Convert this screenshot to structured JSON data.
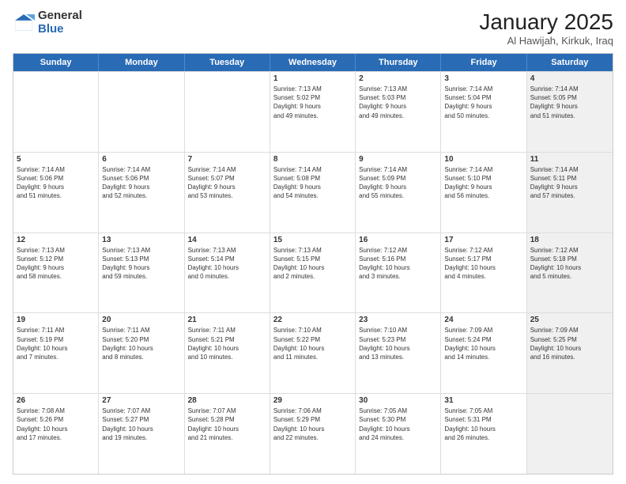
{
  "header": {
    "logo_general": "General",
    "logo_blue": "Blue",
    "month_title": "January 2025",
    "subtitle": "Al Hawijah, Kirkuk, Iraq"
  },
  "days_of_week": [
    "Sunday",
    "Monday",
    "Tuesday",
    "Wednesday",
    "Thursday",
    "Friday",
    "Saturday"
  ],
  "weeks": [
    [
      {
        "num": "",
        "text": "",
        "empty": true,
        "shaded": false
      },
      {
        "num": "",
        "text": "",
        "empty": true,
        "shaded": false
      },
      {
        "num": "",
        "text": "",
        "empty": true,
        "shaded": false
      },
      {
        "num": "1",
        "text": "Sunrise: 7:13 AM\nSunset: 5:02 PM\nDaylight: 9 hours\nand 49 minutes.",
        "empty": false,
        "shaded": false
      },
      {
        "num": "2",
        "text": "Sunrise: 7:13 AM\nSunset: 5:03 PM\nDaylight: 9 hours\nand 49 minutes.",
        "empty": false,
        "shaded": false
      },
      {
        "num": "3",
        "text": "Sunrise: 7:14 AM\nSunset: 5:04 PM\nDaylight: 9 hours\nand 50 minutes.",
        "empty": false,
        "shaded": false
      },
      {
        "num": "4",
        "text": "Sunrise: 7:14 AM\nSunset: 5:05 PM\nDaylight: 9 hours\nand 51 minutes.",
        "empty": false,
        "shaded": true
      }
    ],
    [
      {
        "num": "5",
        "text": "Sunrise: 7:14 AM\nSunset: 5:06 PM\nDaylight: 9 hours\nand 51 minutes.",
        "empty": false,
        "shaded": false
      },
      {
        "num": "6",
        "text": "Sunrise: 7:14 AM\nSunset: 5:06 PM\nDaylight: 9 hours\nand 52 minutes.",
        "empty": false,
        "shaded": false
      },
      {
        "num": "7",
        "text": "Sunrise: 7:14 AM\nSunset: 5:07 PM\nDaylight: 9 hours\nand 53 minutes.",
        "empty": false,
        "shaded": false
      },
      {
        "num": "8",
        "text": "Sunrise: 7:14 AM\nSunset: 5:08 PM\nDaylight: 9 hours\nand 54 minutes.",
        "empty": false,
        "shaded": false
      },
      {
        "num": "9",
        "text": "Sunrise: 7:14 AM\nSunset: 5:09 PM\nDaylight: 9 hours\nand 55 minutes.",
        "empty": false,
        "shaded": false
      },
      {
        "num": "10",
        "text": "Sunrise: 7:14 AM\nSunset: 5:10 PM\nDaylight: 9 hours\nand 56 minutes.",
        "empty": false,
        "shaded": false
      },
      {
        "num": "11",
        "text": "Sunrise: 7:14 AM\nSunset: 5:11 PM\nDaylight: 9 hours\nand 57 minutes.",
        "empty": false,
        "shaded": true
      }
    ],
    [
      {
        "num": "12",
        "text": "Sunrise: 7:13 AM\nSunset: 5:12 PM\nDaylight: 9 hours\nand 58 minutes.",
        "empty": false,
        "shaded": false
      },
      {
        "num": "13",
        "text": "Sunrise: 7:13 AM\nSunset: 5:13 PM\nDaylight: 9 hours\nand 59 minutes.",
        "empty": false,
        "shaded": false
      },
      {
        "num": "14",
        "text": "Sunrise: 7:13 AM\nSunset: 5:14 PM\nDaylight: 10 hours\nand 0 minutes.",
        "empty": false,
        "shaded": false
      },
      {
        "num": "15",
        "text": "Sunrise: 7:13 AM\nSunset: 5:15 PM\nDaylight: 10 hours\nand 2 minutes.",
        "empty": false,
        "shaded": false
      },
      {
        "num": "16",
        "text": "Sunrise: 7:12 AM\nSunset: 5:16 PM\nDaylight: 10 hours\nand 3 minutes.",
        "empty": false,
        "shaded": false
      },
      {
        "num": "17",
        "text": "Sunrise: 7:12 AM\nSunset: 5:17 PM\nDaylight: 10 hours\nand 4 minutes.",
        "empty": false,
        "shaded": false
      },
      {
        "num": "18",
        "text": "Sunrise: 7:12 AM\nSunset: 5:18 PM\nDaylight: 10 hours\nand 5 minutes.",
        "empty": false,
        "shaded": true
      }
    ],
    [
      {
        "num": "19",
        "text": "Sunrise: 7:11 AM\nSunset: 5:19 PM\nDaylight: 10 hours\nand 7 minutes.",
        "empty": false,
        "shaded": false
      },
      {
        "num": "20",
        "text": "Sunrise: 7:11 AM\nSunset: 5:20 PM\nDaylight: 10 hours\nand 8 minutes.",
        "empty": false,
        "shaded": false
      },
      {
        "num": "21",
        "text": "Sunrise: 7:11 AM\nSunset: 5:21 PM\nDaylight: 10 hours\nand 10 minutes.",
        "empty": false,
        "shaded": false
      },
      {
        "num": "22",
        "text": "Sunrise: 7:10 AM\nSunset: 5:22 PM\nDaylight: 10 hours\nand 11 minutes.",
        "empty": false,
        "shaded": false
      },
      {
        "num": "23",
        "text": "Sunrise: 7:10 AM\nSunset: 5:23 PM\nDaylight: 10 hours\nand 13 minutes.",
        "empty": false,
        "shaded": false
      },
      {
        "num": "24",
        "text": "Sunrise: 7:09 AM\nSunset: 5:24 PM\nDaylight: 10 hours\nand 14 minutes.",
        "empty": false,
        "shaded": false
      },
      {
        "num": "25",
        "text": "Sunrise: 7:09 AM\nSunset: 5:25 PM\nDaylight: 10 hours\nand 16 minutes.",
        "empty": false,
        "shaded": true
      }
    ],
    [
      {
        "num": "26",
        "text": "Sunrise: 7:08 AM\nSunset: 5:26 PM\nDaylight: 10 hours\nand 17 minutes.",
        "empty": false,
        "shaded": false
      },
      {
        "num": "27",
        "text": "Sunrise: 7:07 AM\nSunset: 5:27 PM\nDaylight: 10 hours\nand 19 minutes.",
        "empty": false,
        "shaded": false
      },
      {
        "num": "28",
        "text": "Sunrise: 7:07 AM\nSunset: 5:28 PM\nDaylight: 10 hours\nand 21 minutes.",
        "empty": false,
        "shaded": false
      },
      {
        "num": "29",
        "text": "Sunrise: 7:06 AM\nSunset: 5:29 PM\nDaylight: 10 hours\nand 22 minutes.",
        "empty": false,
        "shaded": false
      },
      {
        "num": "30",
        "text": "Sunrise: 7:05 AM\nSunset: 5:30 PM\nDaylight: 10 hours\nand 24 minutes.",
        "empty": false,
        "shaded": false
      },
      {
        "num": "31",
        "text": "Sunrise: 7:05 AM\nSunset: 5:31 PM\nDaylight: 10 hours\nand 26 minutes.",
        "empty": false,
        "shaded": false
      },
      {
        "num": "",
        "text": "",
        "empty": true,
        "shaded": true
      }
    ]
  ]
}
